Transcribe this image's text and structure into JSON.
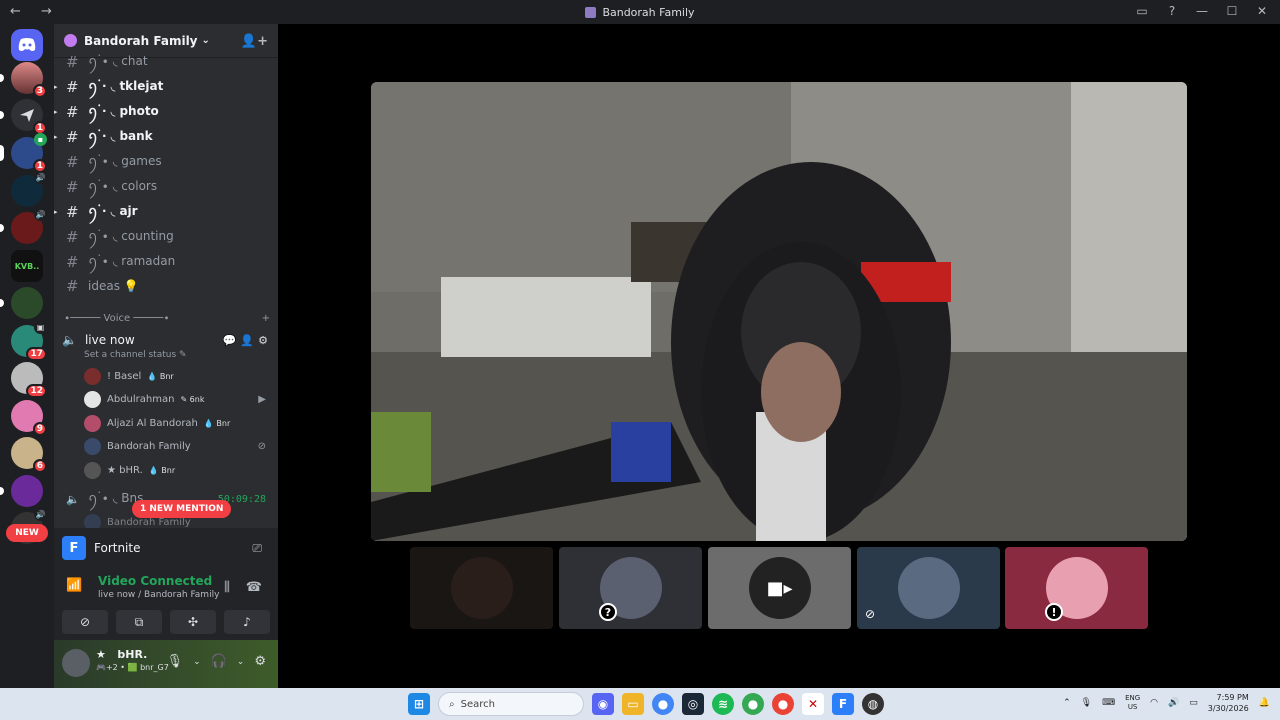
{
  "window": {
    "title": "Bandorah Family"
  },
  "servers": {
    "badges": [
      "3",
      "1",
      "1",
      "17",
      "12",
      "9",
      "6"
    ],
    "new_label": "NEW"
  },
  "guild": {
    "name": "Bandorah Family"
  },
  "channels": [
    {
      "name": "ꪆ۬ ∙ ◟ chat",
      "unread": false,
      "icon": "chat"
    },
    {
      "name": "ꪆ۬ ∙ ◟ tklejat",
      "unread": true,
      "icon": "page"
    },
    {
      "name": "ꪆ۬ ∙ ◟ photo",
      "unread": true,
      "icon": "camera"
    },
    {
      "name": "ꪆ۬ ∙ ◟ bank",
      "unread": true,
      "icon": "bank"
    },
    {
      "name": "ꪆ۬ ∙ ◟ games",
      "unread": false,
      "icon": "game"
    },
    {
      "name": "ꪆ۬ ∙ ◟ colors",
      "unread": false,
      "icon": "palette"
    },
    {
      "name": "ꪆ۬ ∙ ◟ ajr",
      "unread": true,
      "icon": "hands"
    },
    {
      "name": "ꪆ۬ ∙ ◟ counting",
      "unread": false,
      "icon": "numbers"
    },
    {
      "name": "ꪆ۬ ∙ ◟ ramadan",
      "unread": false,
      "icon": "moon"
    },
    {
      "name": "ideas 💡",
      "unread": false,
      "icon": "bulb"
    }
  ],
  "voice": {
    "category": "∙───── Voice ─────∙",
    "channel_name": "live now",
    "status_hint": "Set a channel status ✎",
    "users": [
      {
        "name": "! Basel",
        "tag": "💧 Bnr",
        "right": "",
        "color": "#7a2d2d"
      },
      {
        "name": "Abdulrahman",
        "tag": "✎ 6nk",
        "right": "🎥",
        "color": "#e5e5e5"
      },
      {
        "name": "Aljazi Al Bandorah",
        "tag": "💧 Bnr",
        "right": "",
        "color": "#b44d6a"
      },
      {
        "name": "Bandorah Family",
        "tag": "",
        "right": "⊘",
        "color": "#3a4a6a"
      },
      {
        "name": "★     bHR.",
        "tag": "💧 Bnr",
        "right": "",
        "color": "#555555"
      }
    ],
    "second_channel": "ꪆ۬ ∙ ◟ Bns",
    "second_user": "Bandorah Family",
    "mention": "1 NEW MENTION",
    "timer": "50:09:28"
  },
  "panel": {
    "activity": "Fortnite",
    "connection_title": "Video Connected",
    "connection_sub": "live now / Bandorah Family"
  },
  "user": {
    "name": "bHR.",
    "star": "★",
    "status": "🎮+2 • 🟩 bnr_G7"
  },
  "taskbar": {
    "search": "Search",
    "lang_top": "ENG",
    "lang_bottom": "US",
    "time": "7:59 PM",
    "date": "3/30/2026"
  },
  "colors": {
    "accent": "#5865f2",
    "green": "#23a55a",
    "red": "#f23f43"
  }
}
